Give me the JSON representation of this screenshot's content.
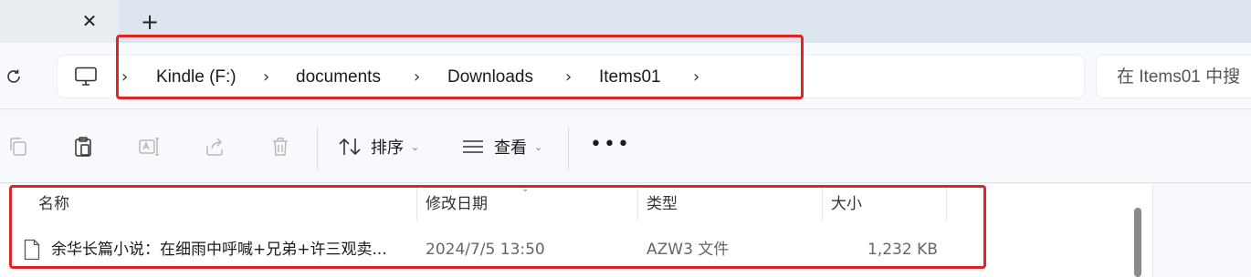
{
  "tabstrip": {
    "close_glyph": "✕",
    "new_tab_glyph": "+"
  },
  "address": {
    "refresh_icon": "refresh-icon",
    "root_icon": "computer-icon",
    "separator": "›",
    "crumbs": [
      "Kindle (F:)",
      "documents",
      "Downloads",
      "Items01"
    ]
  },
  "search": {
    "placeholder": "在 Items01 中搜"
  },
  "toolbar": {
    "buttons": [
      {
        "icon": "copy-icon"
      },
      {
        "icon": "paste-icon"
      },
      {
        "icon": "rename-icon"
      },
      {
        "icon": "share-icon"
      },
      {
        "icon": "delete-icon"
      }
    ],
    "sort_label": "排序",
    "view_label": "查看",
    "more_label": "•••",
    "chevron": "⌄"
  },
  "filelist": {
    "columns": {
      "name": "名称",
      "modified": "修改日期",
      "type": "类型",
      "size": "大小"
    },
    "sort_caret": "⌄",
    "rows": [
      {
        "name": "余华长篇小说：在细雨中呼喊+兄弟+许三观卖...",
        "modified": "2024/7/5 13:50",
        "type": "AZW3 文件",
        "size": "1,232 KB"
      }
    ]
  },
  "colors": {
    "highlight": "#e02424",
    "accent": "#0067c0"
  }
}
